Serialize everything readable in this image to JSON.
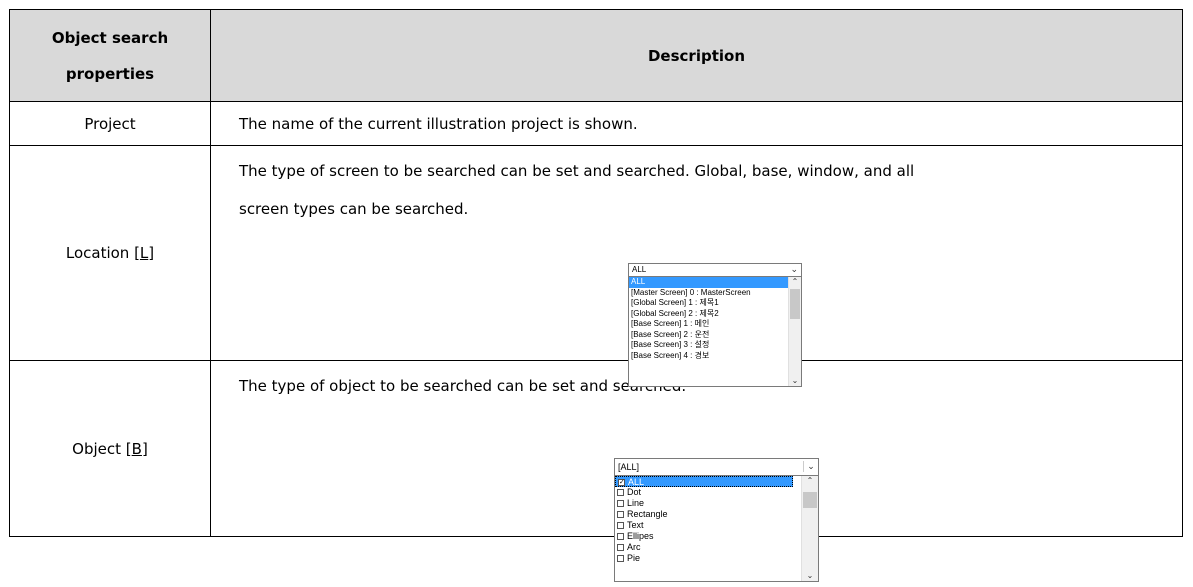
{
  "table": {
    "header": {
      "col1_line1": "Object search",
      "col1_line2": "properties",
      "col2": "Description"
    },
    "rows": [
      {
        "property": "Project",
        "description": "The name of the current illustration project is shown."
      },
      {
        "property_text": "Location [",
        "property_key": "L",
        "property_end": "]",
        "description_line1": "The type of screen to be searched can be set and searched. Global, base, window, and all",
        "description_line2": "screen types can be searched."
      },
      {
        "property_text": "Object [",
        "property_key": "B",
        "property_end": "]",
        "description": "The type of object to be searched can be set and searched."
      }
    ]
  },
  "location_dropdown": {
    "selected": "ALL",
    "items": [
      "ALL",
      "[Master Screen] 0 : MasterScreen",
      "[Global Screen] 1 : 제목1",
      "[Global Screen] 2 : 제목2",
      "[Base Screen] 1 : 메인",
      "[Base Screen] 2 : 운전",
      "[Base Screen] 3 : 설정",
      "[Base Screen] 4 : 경보"
    ]
  },
  "object_dropdown": {
    "selected": "[ALL]",
    "items": [
      {
        "label": "ALL",
        "checked": true
      },
      {
        "label": "Dot",
        "checked": false
      },
      {
        "label": "Line",
        "checked": false
      },
      {
        "label": "Rectangle",
        "checked": false
      },
      {
        "label": "Text",
        "checked": false
      },
      {
        "label": "Ellipes",
        "checked": false
      },
      {
        "label": "Arc",
        "checked": false
      },
      {
        "label": "Pie",
        "checked": false
      }
    ]
  }
}
